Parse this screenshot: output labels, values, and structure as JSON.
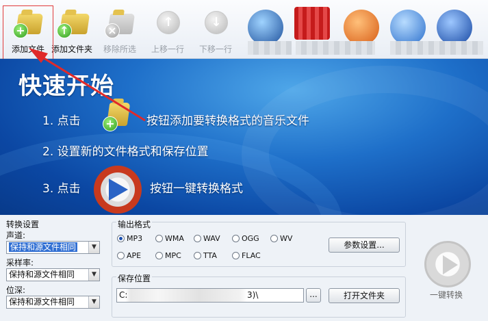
{
  "toolbar": {
    "add_file": "添加文件",
    "add_folder": "添加文件夹",
    "remove_all": "移除所选",
    "move_up": "上移一行",
    "move_down": "下移一行"
  },
  "banner": {
    "title": "快速开始",
    "step1_prefix": "1. 点击",
    "step1_suffix": "按钮添加要转换格式的音乐文件",
    "step2": "2. 设置新的文件格式和保存位置",
    "step3_prefix": "3. 点击",
    "step3_suffix": "按钮一键转换格式"
  },
  "convert_settings": {
    "label": "转换设置",
    "channel_label": "声道:",
    "channel_value": "保持和源文件相同",
    "samplerate_label": "采样率:",
    "samplerate_value": "保持和源文件相同",
    "bitdepth_label": "位深:",
    "bitdepth_value": "保持和源文件相同"
  },
  "output_format": {
    "label": "输出格式",
    "options": [
      "MP3",
      "WMA",
      "WAV",
      "OGG",
      "WV",
      "APE",
      "MPC",
      "TTA",
      "FLAC"
    ],
    "selected": "MP3",
    "params_button": "参数设置..."
  },
  "save_location": {
    "label": "保存位置",
    "path_start": "C:",
    "path_end": "3)\\",
    "browse_button": "...",
    "open_folder_button": "打开文件夹",
    "convert_label": "一键转换"
  },
  "colors": {
    "highlight_box": "#e03a3a",
    "annotation_arrow": "#e02a2a",
    "banner_blue": "#1e6fc9"
  }
}
